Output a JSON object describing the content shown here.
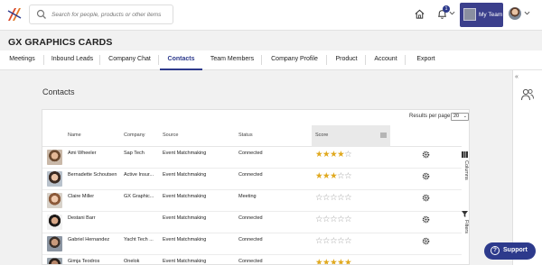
{
  "topbar": {
    "search_placeholder": "Search for people, products or other items",
    "notification_count": "1",
    "my_team_label": "My Team"
  },
  "company_name": "GX GRAPHICS CARDS",
  "tabs": [
    {
      "label": "Meetings",
      "active": false
    },
    {
      "label": "Inbound Leads",
      "active": false
    },
    {
      "label": "Company Chat",
      "active": false
    },
    {
      "label": "Contacts",
      "active": true
    },
    {
      "label": "Team Members",
      "active": false
    },
    {
      "label": "Company Profile",
      "active": false
    },
    {
      "label": "Product",
      "active": false
    },
    {
      "label": "Account",
      "active": false
    },
    {
      "label": "Export",
      "active": false
    }
  ],
  "contacts": {
    "title": "Contacts",
    "results_per_page_label": "Results per page:",
    "results_per_page_value": "20",
    "columns": {
      "name": "Name",
      "company": "Company",
      "source": "Source",
      "status": "Status",
      "score": "Score"
    },
    "side_tabs": {
      "columns": "Columns",
      "filters": "Filters"
    },
    "rows": [
      {
        "name": "Ami Wheeler",
        "company": "Sap Tech",
        "source": "Event Matchmaking",
        "status": "Connected",
        "score": 4
      },
      {
        "name": "Bernadette Schoutsen",
        "company": "Active Insur...",
        "source": "Event Matchmaking",
        "status": "Connected",
        "score": 3
      },
      {
        "name": "Claire Miller",
        "company": "GX Graphic...",
        "source": "Event Matchmaking",
        "status": "Meeting",
        "score": 0
      },
      {
        "name": "Destani Barr",
        "company": "",
        "source": "Event Matchmaking",
        "status": "Connected",
        "score": 0
      },
      {
        "name": "Gabriel Hernandez",
        "company": "Yacht Tech ...",
        "source": "Event Matchmaking",
        "status": "Connected",
        "score": 0
      },
      {
        "name": "Gimja Teodros",
        "company": "Onelok",
        "source": "Event Matchmaking",
        "status": "Connected",
        "score": 5
      }
    ]
  },
  "support_label": "Support",
  "colors": {
    "brand": "#2d3a8c",
    "star": "#e0a81d"
  }
}
